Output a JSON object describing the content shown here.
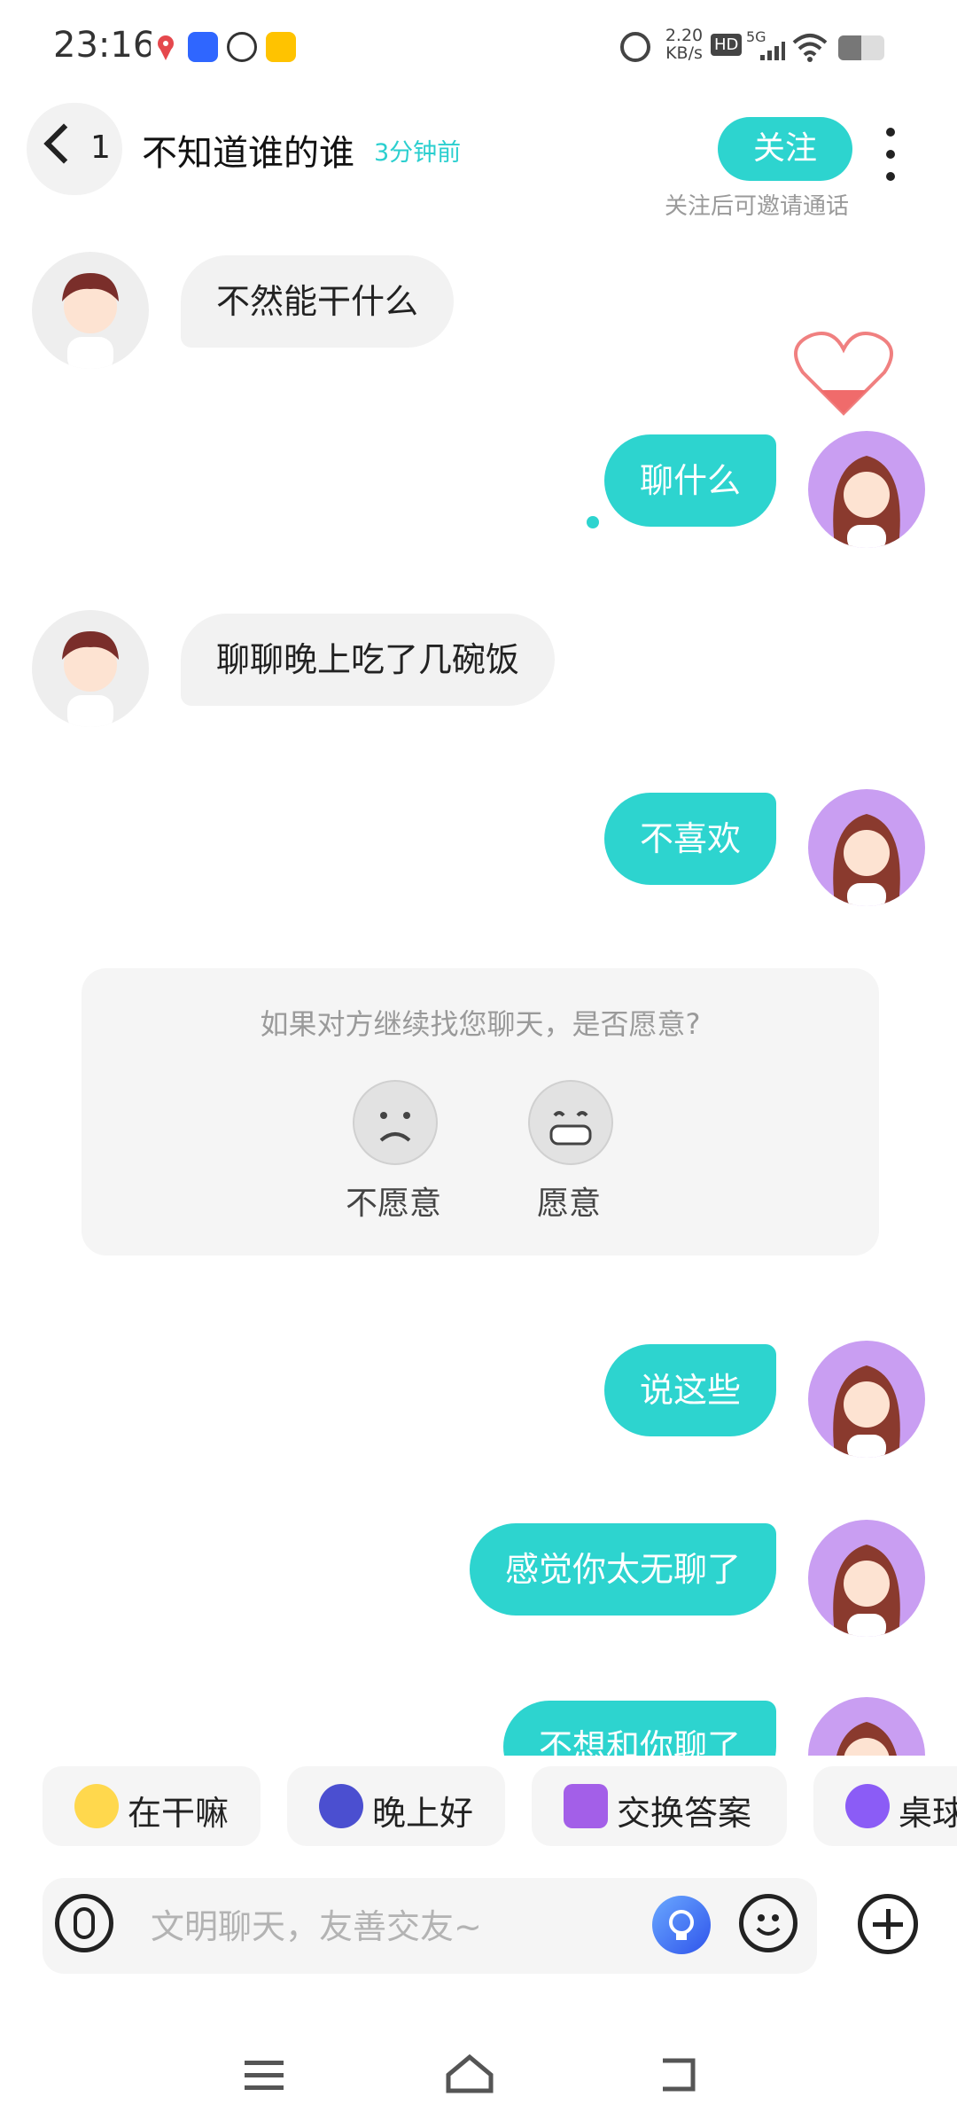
{
  "status_bar": {
    "time": "23:16",
    "network_speed": "2.20",
    "network_speed_unit": "KB/s",
    "hd_badge": "HD",
    "network_type": "5G"
  },
  "header": {
    "back_count": "1",
    "contact_name": "不知道谁的谁",
    "last_seen": "3分钟前",
    "follow_label": "关注",
    "follow_hint": "关注后可邀请通话"
  },
  "messages": [
    {
      "side": "in",
      "text": "不然能干什么"
    },
    {
      "side": "out",
      "text": "聊什么"
    },
    {
      "side": "in",
      "text": "聊聊晚上吃了几碗饭"
    },
    {
      "side": "out",
      "text": "不喜欢"
    },
    {
      "side": "out",
      "text": "说这些"
    },
    {
      "side": "out",
      "text": "感觉你太无聊了"
    },
    {
      "side": "out",
      "text": "不想和你聊了"
    }
  ],
  "survey": {
    "question": "如果对方继续找您聊天，是否愿意?",
    "options": [
      "不愿意",
      "愿意"
    ]
  },
  "quick_replies": [
    "在干嘛",
    "晚上好",
    "交换答案",
    "桌球"
  ],
  "input": {
    "placeholder": "文明聊天，友善交友~"
  },
  "colors": {
    "accent": "#2dd4cf",
    "incoming_bubble": "#f2f2f2"
  }
}
